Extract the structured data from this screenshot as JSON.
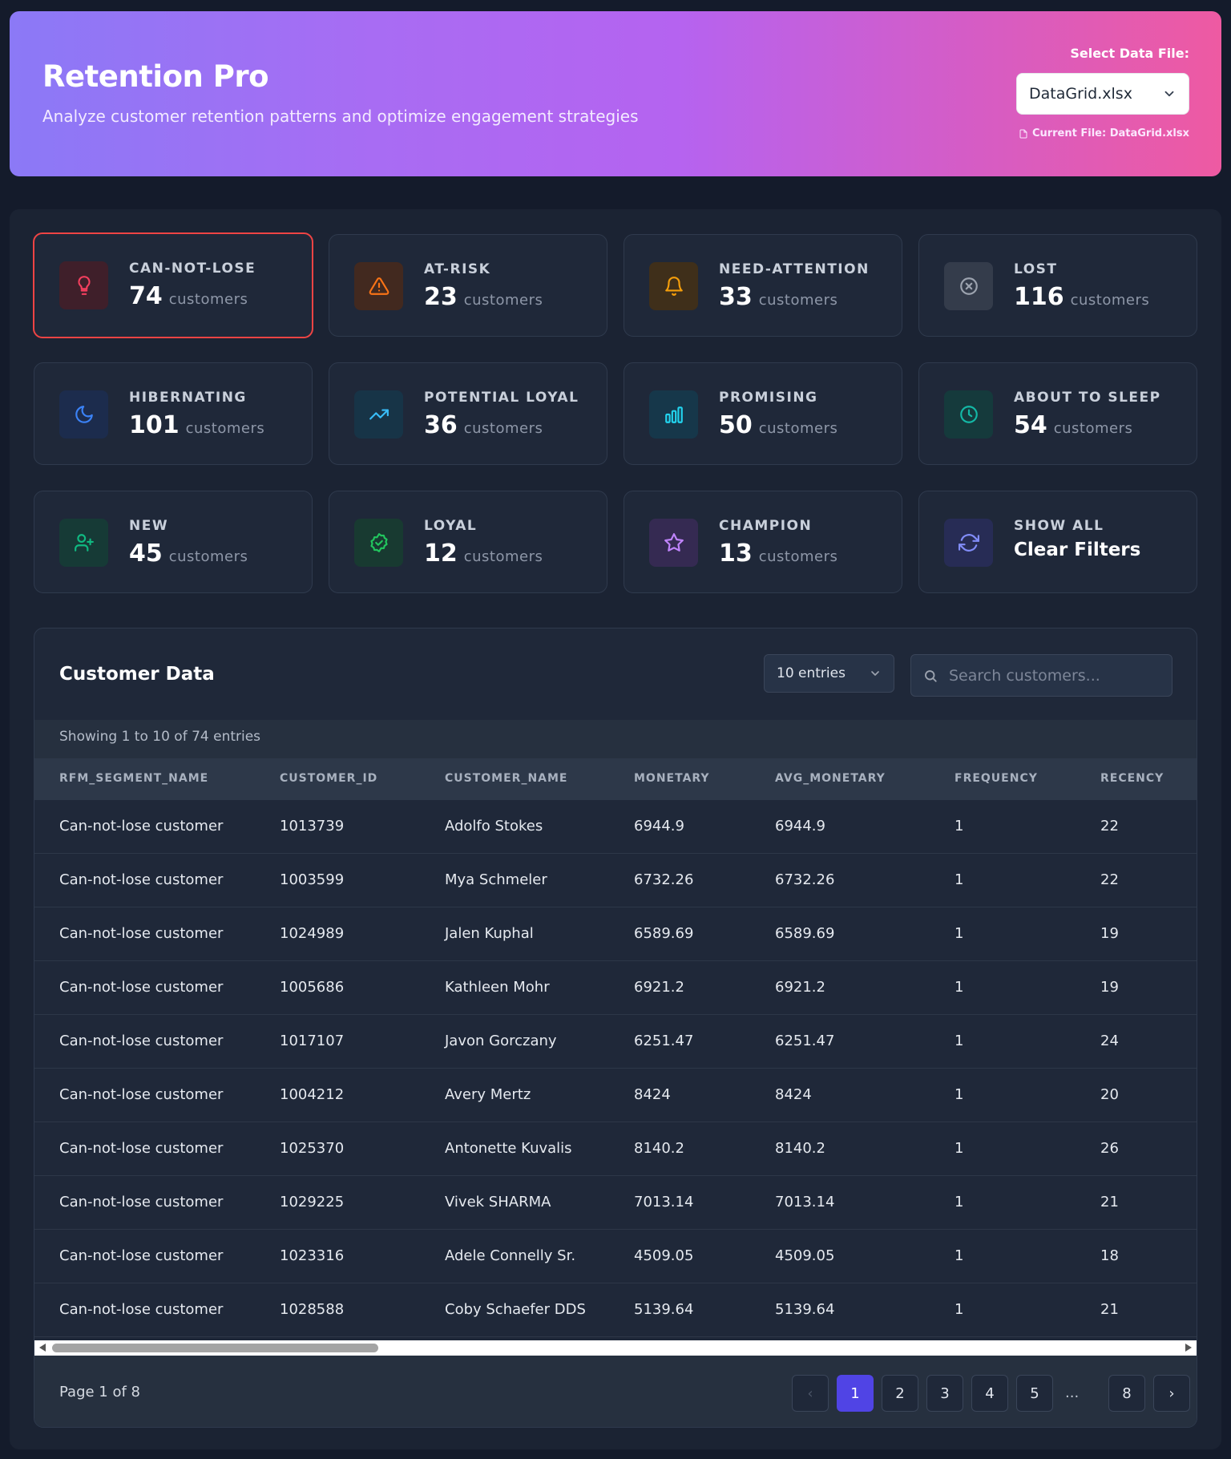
{
  "header": {
    "title": "Retention Pro",
    "subtitle": "Analyze customer retention patterns and optimize engagement strategies",
    "file_label": "Select Data File:",
    "file_selected": "DataGrid.xlsx",
    "current_file": "Current File: DataGrid.xlsx"
  },
  "segments": [
    {
      "label": "CAN-NOT-LOSE",
      "count": "74",
      "unit": "customers",
      "icon": "lightbulb-icon",
      "color": "#f43f5e",
      "bg": "#3f1f2a",
      "active": true
    },
    {
      "label": "AT-RISK",
      "count": "23",
      "unit": "customers",
      "icon": "warning-icon",
      "color": "#f97316",
      "bg": "#42291f"
    },
    {
      "label": "NEED-ATTENTION",
      "count": "33",
      "unit": "customers",
      "icon": "bell-icon",
      "color": "#f59e0b",
      "bg": "#3f2f1a"
    },
    {
      "label": "LOST",
      "count": "116",
      "unit": "customers",
      "icon": "x-circle-icon",
      "color": "#9ca3af",
      "bg": "#343c4b"
    },
    {
      "label": "HIBERNATING",
      "count": "101",
      "unit": "customers",
      "icon": "moon-icon",
      "color": "#3b82f6",
      "bg": "#1c2c4d"
    },
    {
      "label": "POTENTIAL LOYAL",
      "count": "36",
      "unit": "customers",
      "icon": "trending-up-icon",
      "color": "#38bdf8",
      "bg": "#173447"
    },
    {
      "label": "PROMISING",
      "count": "50",
      "unit": "customers",
      "icon": "bar-chart-icon",
      "color": "#22d3ee",
      "bg": "#16374a"
    },
    {
      "label": "ABOUT TO SLEEP",
      "count": "54",
      "unit": "customers",
      "icon": "clock-icon",
      "color": "#14b8a6",
      "bg": "#153a3c"
    },
    {
      "label": "NEW",
      "count": "45",
      "unit": "customers",
      "icon": "user-plus-icon",
      "color": "#10b981",
      "bg": "#163a36"
    },
    {
      "label": "LOYAL",
      "count": "12",
      "unit": "customers",
      "icon": "badge-check-icon",
      "color": "#22c55e",
      "bg": "#183a31"
    },
    {
      "label": "CHAMPION",
      "count": "13",
      "unit": "customers",
      "icon": "star-icon",
      "color": "#c084fc",
      "bg": "#352a52"
    },
    {
      "label": "SHOW ALL",
      "strong": "Clear Filters",
      "icon": "refresh-icon",
      "color": "#818cf8",
      "bg": "#272c55"
    }
  ],
  "table": {
    "title": "Customer Data",
    "entries": "10 entries",
    "search_placeholder": "Search customers...",
    "showing": "Showing 1 to 10 of 74 entries",
    "columns": [
      "RFM_SEGMENT_NAME",
      "CUSTOMER_ID",
      "CUSTOMER_NAME",
      "MONETARY",
      "AVG_MONETARY",
      "FREQUENCY",
      "RECENCY"
    ],
    "rows": [
      [
        "Can-not-lose customer",
        "1013739",
        "Adolfo Stokes",
        "6944.9",
        "6944.9",
        "1",
        "22"
      ],
      [
        "Can-not-lose customer",
        "1003599",
        "Mya Schmeler",
        "6732.26",
        "6732.26",
        "1",
        "22"
      ],
      [
        "Can-not-lose customer",
        "1024989",
        "Jalen Kuphal",
        "6589.69",
        "6589.69",
        "1",
        "19"
      ],
      [
        "Can-not-lose customer",
        "1005686",
        "Kathleen Mohr",
        "6921.2",
        "6921.2",
        "1",
        "19"
      ],
      [
        "Can-not-lose customer",
        "1017107",
        "Javon Gorczany",
        "6251.47",
        "6251.47",
        "1",
        "24"
      ],
      [
        "Can-not-lose customer",
        "1004212",
        "Avery Mertz",
        "8424",
        "8424",
        "1",
        "20"
      ],
      [
        "Can-not-lose customer",
        "1025370",
        "Antonette Kuvalis",
        "8140.2",
        "8140.2",
        "1",
        "26"
      ],
      [
        "Can-not-lose customer",
        "1029225",
        "Vivek SHARMA",
        "7013.14",
        "7013.14",
        "1",
        "21"
      ],
      [
        "Can-not-lose customer",
        "1023316",
        "Adele Connelly Sr.",
        "4509.05",
        "4509.05",
        "1",
        "18"
      ],
      [
        "Can-not-lose customer",
        "1028588",
        "Coby Schaefer DDS",
        "5139.64",
        "5139.64",
        "1",
        "21"
      ]
    ],
    "page_info": "Page 1 of 8",
    "pages": [
      "1",
      "2",
      "3",
      "4",
      "5",
      "...",
      "8"
    ],
    "prev": "‹",
    "next": "›"
  }
}
